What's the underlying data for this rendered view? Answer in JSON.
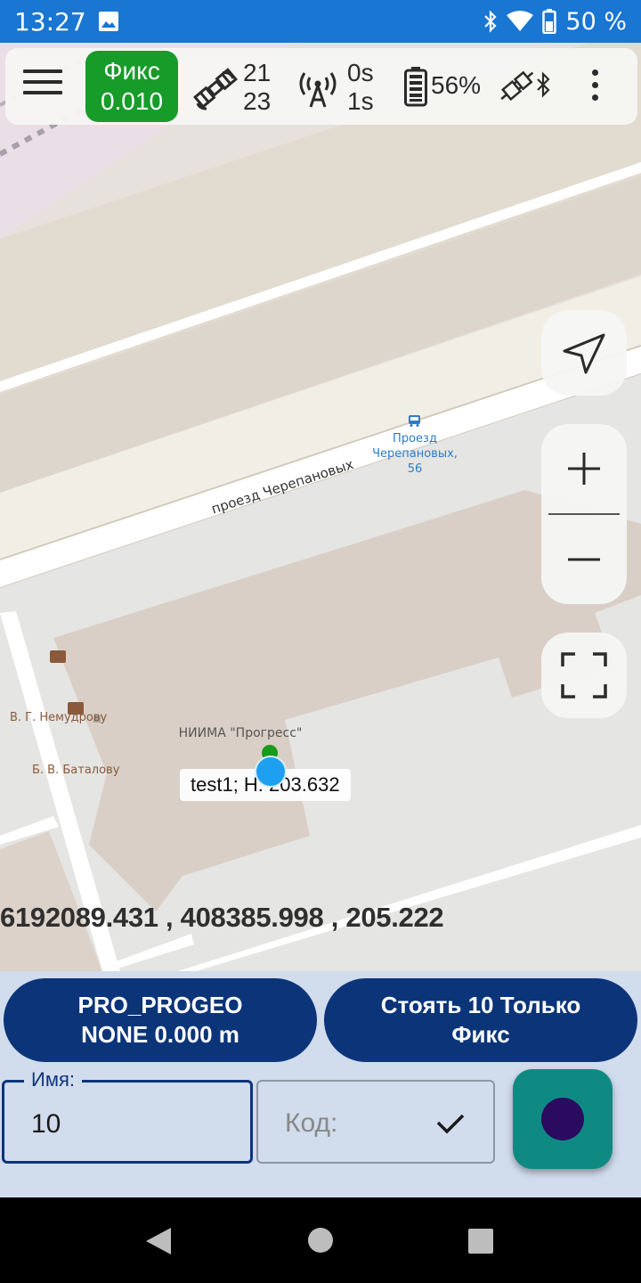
{
  "status_bar": {
    "time": "13:27",
    "battery_percent": "50 %",
    "icons": [
      "image-icon",
      "bluetooth-icon",
      "wifi-icon",
      "battery-icon"
    ]
  },
  "toolbar": {
    "fix_status": "Фикс",
    "fix_value": "0.010",
    "sats_used": "21",
    "sats_visible": "23",
    "corr_age": "0s",
    "corr_interval": "1s",
    "receiver_battery": "56%",
    "icons": [
      "menu-icon",
      "satellite-icon",
      "antenna-icon",
      "battery-icon",
      "plug-bluetooth-icon",
      "more-vert-icon"
    ]
  },
  "map": {
    "street_name": "проезд Черепановых",
    "bus_stop": "Проезд Черепановых, 56",
    "poi_1": "В. Г. Немудрову",
    "poi_2": "Б. В. Баталову",
    "building": "НИИМА \"Прогресс\"",
    "point_label": "test1; H: 203.632",
    "coordinates": "6192089.431 , 408385.998 , 205.222",
    "controls": [
      "navigate-icon",
      "zoom-in-icon",
      "zoom-out-icon",
      "fullscreen-icon"
    ]
  },
  "bottom_panel": {
    "profile_line1": "PRO_PROGEO",
    "profile_line2": "NONE 0.000 m",
    "mode_line1": "Стоять 10 Только",
    "mode_line2": "Фикс",
    "name_label": "Имя:",
    "name_value": "10",
    "code_placeholder": "Код:"
  },
  "colors": {
    "status_bar": "#1976d2",
    "fix_badge": "#179c2a",
    "primary_dark": "#0c3579",
    "record_button": "#0f8a83",
    "location_dot": "#1ea0f0"
  }
}
